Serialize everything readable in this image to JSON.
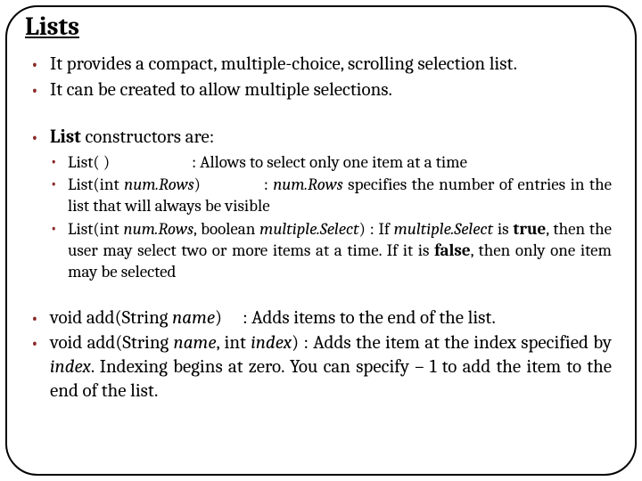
{
  "title": "Lists",
  "b1": "It provides a compact, multiple-choice, scrolling selection list.",
  "b2": "It can be created to allow multiple selections.",
  "b3_bold": "List",
  "b3_rest": " constructors are:",
  "c1_sig": "List( )",
  "c1_desc": ": Allows to select only one item at a time",
  "c2_sig_a": "List(int ",
  "c2_sig_i": "num.Rows",
  "c2_sig_b": ")",
  "c2_desc_a": ": ",
  "c2_desc_i": "num.Rows",
  "c2_desc_b": " specifies the number of entries in the list that will always be visible",
  "c3_sig_a": "List(int ",
  "c3_sig_i1": "num.Rows",
  "c3_sig_b": ", boolean ",
  "c3_sig_i2": "multiple.Select",
  "c3_sig_c": ")",
  "c3_desc_a": " : If ",
  "c3_desc_i1": "multiple.Select",
  "c3_desc_b": " is ",
  "c3_desc_bold1": "true",
  "c3_desc_c": ", then the user may select two or more items at a time. If it is ",
  "c3_desc_bold2": "false",
  "c3_desc_d": ", then only one item may be selected",
  "b4_sig_a": "void add(String ",
  "b4_sig_i": "name",
  "b4_sig_b": ")",
  "b4_desc": ": Adds items to the end of the list.",
  "b5_sig_a": "void add(String ",
  "b5_sig_i1": "name",
  "b5_sig_b": ", int ",
  "b5_sig_i2": "index",
  "b5_sig_c": ")",
  "b5_desc_a": " : Adds the item at the index specified by ",
  "b5_desc_i": "index",
  "b5_desc_b": ". Indexing begins at zero. You can specify – 1 to add the item to the end of the list."
}
